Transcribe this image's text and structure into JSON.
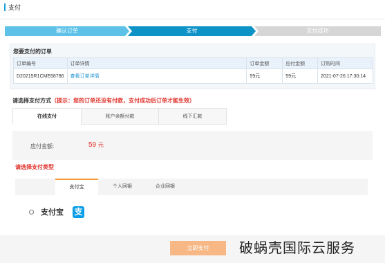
{
  "header": {
    "title": "支付"
  },
  "steps": [
    {
      "label": "确认订单",
      "state": "done"
    },
    {
      "label": "支付",
      "state": "current"
    },
    {
      "label": "支付成功",
      "state": "pending"
    }
  ],
  "order_section": {
    "title": "您要支付的订单",
    "columns": [
      "订单编号",
      "订单详情",
      "订单金额",
      "应付金额",
      "订购时间"
    ],
    "rows": [
      {
        "order_no": "D20215R1CME68786",
        "detail_link": "查看订单详情",
        "order_amount": "59",
        "payable_amount": "59",
        "currency_unit": "元",
        "order_time": "2021-07-26 17:30:14"
      }
    ]
  },
  "pay_method": {
    "label": "请选择支付方式",
    "tip": "（提示：您的订单还没有付款，支付成功后订单才能生效）",
    "tabs": [
      "在线支付",
      "账户余额付款",
      "线下汇款"
    ],
    "active_tab": 0
  },
  "amount": {
    "label": "应付金额:",
    "value": "59",
    "unit": "元"
  },
  "pay_type": {
    "label": "请选择支付类型",
    "tabs": [
      "支付宝",
      "个人网银",
      "企业网银"
    ],
    "active_tab": 0
  },
  "alipay_option": {
    "label": "支付宝",
    "logo_char": "支",
    "selected": false
  },
  "submit_button": {
    "label": "立即支付"
  },
  "watermark": "破蜗壳国际云服务",
  "colors": {
    "accent": "#0e93c7",
    "step_done": "#5ec2e8",
    "price_red": "#e0332c",
    "submit_orange": "#f7b885"
  }
}
